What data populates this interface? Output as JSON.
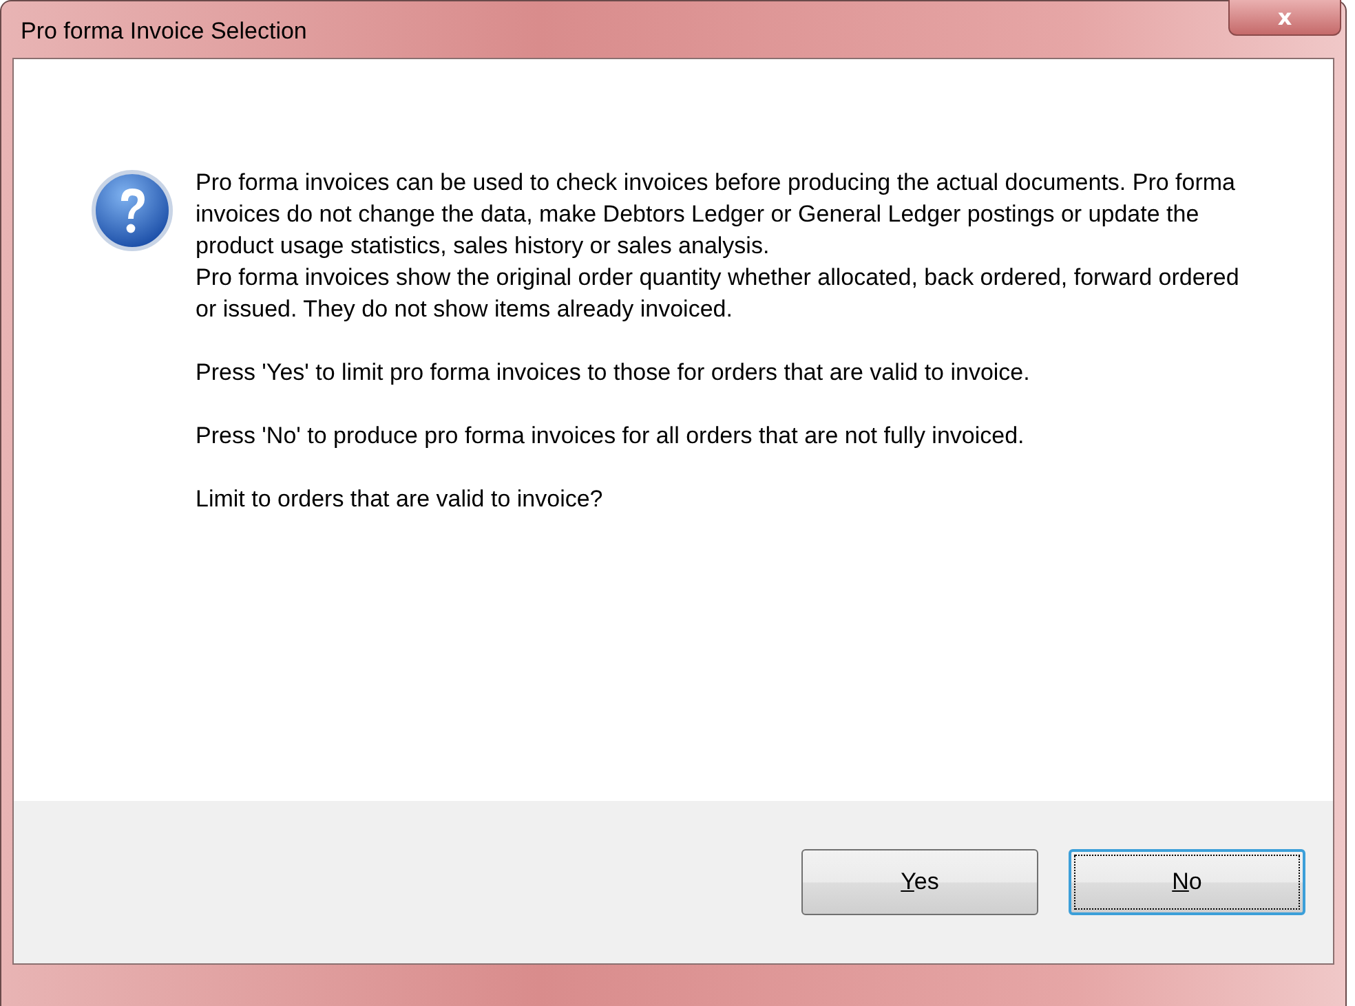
{
  "window": {
    "title": "Pro forma Invoice Selection",
    "close_button": "x"
  },
  "message_groups": [
    [
      "Pro forma invoices can be used to check invoices before producing the actual documents.  Pro forma invoices do not change the data, make Debtors Ledger or General Ledger postings or update the product usage statistics, sales history or sales analysis.",
      "Pro forma invoices show the original order quantity whether allocated, back ordered, forward ordered or issued. They do not show items already invoiced."
    ],
    [
      "Press 'Yes' to limit pro forma invoices to those for orders that are valid to invoice."
    ],
    [
      "Press 'No' to produce pro forma invoices for all orders that are not fully invoiced."
    ],
    [
      "Limit to orders that are valid to invoice?"
    ]
  ],
  "buttons": [
    {
      "label": "Yes",
      "access_key_underlined": true,
      "focused": false
    },
    {
      "label": "No",
      "access_key_underlined": true,
      "focused": true
    }
  ]
}
